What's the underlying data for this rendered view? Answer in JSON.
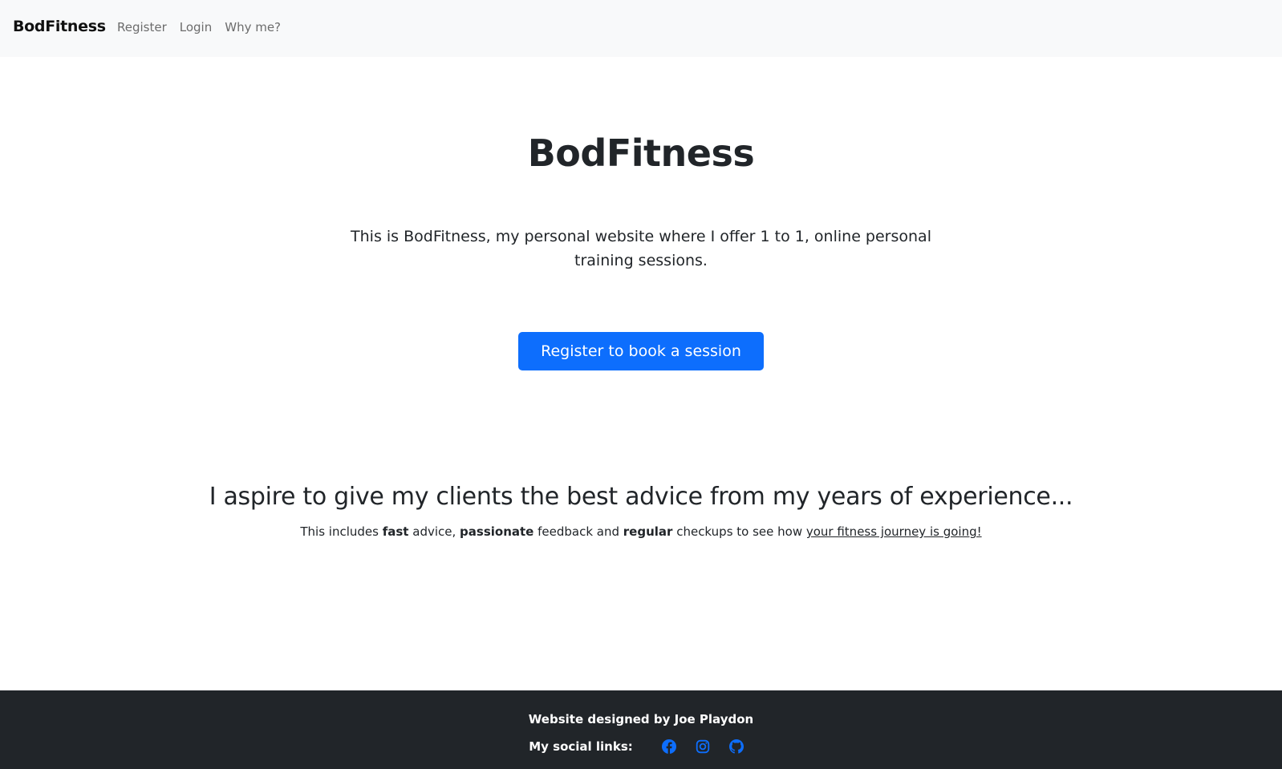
{
  "navbar": {
    "brand": "BodFitness",
    "links": [
      "Register",
      "Login",
      "Why me?"
    ]
  },
  "hero": {
    "title": "BodFitness",
    "lead": "This is BodFitness, my personal website where I offer 1 to 1, online personal training sessions.",
    "cta_label": "Register to book a session"
  },
  "aspire": {
    "heading": "I aspire to give my clients the best advice from my years of experience...",
    "text_1": "This includes ",
    "bold_1": "fast",
    "text_2": " advice, ",
    "bold_2": "passionate",
    "text_3": " feedback and ",
    "bold_3": "regular",
    "text_4": " checkups to see how ",
    "link": "your fitness journey is going!"
  },
  "footer": {
    "credit": "Website designed by Joe Playdon",
    "social_label": "My social links:",
    "icons": [
      "facebook-icon",
      "instagram-icon",
      "github-icon"
    ]
  },
  "colors": {
    "primary": "#0d6efd",
    "navbar_bg": "#f8f9fa",
    "footer_bg": "#212529",
    "text": "#212529",
    "nav_link": "#6c6c6c"
  }
}
